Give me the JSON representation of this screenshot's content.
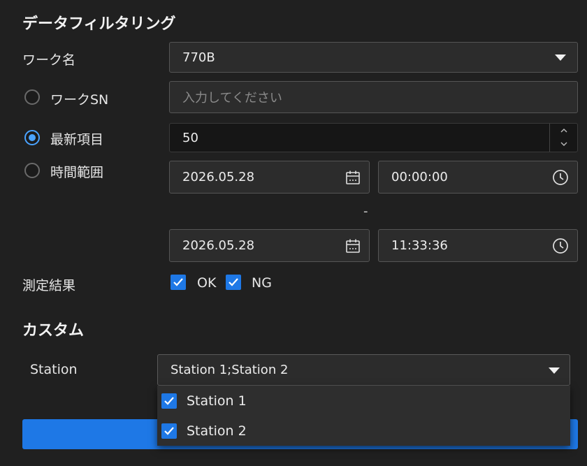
{
  "filter": {
    "title": "データフィルタリング",
    "work_name_label": "ワーク名",
    "work_name_value": "770B",
    "work_sn_label": "ワークSN",
    "work_sn_placeholder": "入力してください",
    "latest_label": "最新項目",
    "latest_value": "50",
    "time_range_label": "時間範囲",
    "start_date": "2026.05.28",
    "start_time": "00:00:00",
    "separator": "-",
    "end_date": "2026.05.28",
    "end_time": "11:33:36",
    "selected_mode": "latest",
    "result_label": "測定結果",
    "result_ok_label": "OK",
    "result_ng_label": "NG",
    "result_ok_checked": true,
    "result_ng_checked": true
  },
  "custom": {
    "title": "カスタム",
    "station_label": "Station",
    "station_value": "Station 1;Station 2",
    "station_options": [
      {
        "label": "Station 1",
        "checked": true
      },
      {
        "label": "Station 2",
        "checked": true
      }
    ]
  },
  "colors": {
    "accent": "#1e78e6",
    "radio_active": "#4aa3ff",
    "background": "#202020"
  },
  "icons": {
    "date": "calendar-icon",
    "time": "clock-icon",
    "select": "caret-down-icon",
    "check": "checkmark-icon"
  }
}
